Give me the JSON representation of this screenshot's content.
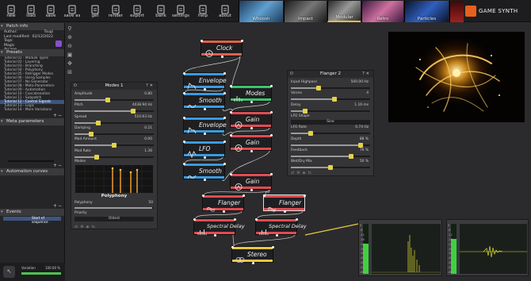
{
  "toolbar": {
    "buttons": [
      {
        "label": "new",
        "icon": "new-file-icon"
      },
      {
        "label": "load",
        "icon": "folder-icon"
      },
      {
        "label": "save",
        "icon": "save-icon"
      },
      {
        "label": "save as",
        "icon": "save-as-icon"
      },
      {
        "label": "get",
        "icon": "download-icon"
      },
      {
        "label": "render",
        "icon": "render-icon"
      },
      {
        "label": "export",
        "icon": "export-icon"
      },
      {
        "label": "bank",
        "icon": "bank-icon"
      },
      {
        "label": "settings",
        "icon": "gear-icon"
      },
      {
        "label": "help",
        "icon": "help-icon"
      },
      {
        "label": "about",
        "icon": "info-icon"
      }
    ],
    "tabs": [
      "Whoosh",
      "Impact",
      "Modular",
      "Retro",
      "Particles"
    ],
    "brand": "GAME SYNTH"
  },
  "left_panel": {
    "patch_info": {
      "header": "Patch info",
      "author_label": "Author:",
      "author_value": "Tsugi",
      "modified_label": "Last modified:",
      "modified_value": "02/12/2022",
      "tags_label": "Tags:",
      "tags_value": "Magic\nArcane"
    },
    "presets": {
      "header": "Presets",
      "items": [
        "Tutorial 01 - Module Types",
        "Tutorial 02 - Layering",
        "Tutorial 03 - Branching",
        "Tutorial 04 - Polyphony",
        "Tutorial 05 - Retrigger Modes",
        "Tutorial 06 - Using Samples",
        "Tutorial 07 - No Generator",
        "Tutorial 08 - Meta Parameters",
        "Tutorial 09 - Automation",
        "Tutorial 10 - Concatenation",
        "Tutorial 11 - Subpatch",
        "Tutorial 12 - Control Signals",
        "Tutorial 13 - Logic",
        "Tutorial 14 - More Variations"
      ],
      "selected": 11
    },
    "meta_parameters": {
      "header": "Meta parameters"
    },
    "automation_curves": {
      "header": "Automation curves"
    },
    "events": {
      "header": "Events",
      "event_value": "Start of sequence"
    },
    "status": {
      "variation_label": "Variation",
      "variation_value": "100.00 %"
    }
  },
  "modes_panel": {
    "title": "Modes 1",
    "params": [
      {
        "label": "Amplitude",
        "value": "0.80",
        "fill": 0.42
      },
      {
        "label": "Pitch",
        "value": "4038.94 Hz",
        "fill": 0.74
      },
      {
        "label": "Spread",
        "value": "510.63 Hz",
        "fill": 0.3
      },
      {
        "label": "Damping",
        "value": "0.21",
        "fill": 0.21
      },
      {
        "label": "Mod Amount",
        "value": "0.00",
        "fill": 0.5
      },
      {
        "label": "Mod Rate",
        "value": "1.36",
        "fill": 0.28
      }
    ],
    "modes_label": "Modes",
    "polyphony_header": "Polyphony",
    "polyphony_label": "Polyphony",
    "polyphony_value": "50",
    "priority_label": "Priority",
    "priority_value": "Oldest"
  },
  "flanger_panel": {
    "title": "Flanger 2",
    "params": [
      {
        "label": "Input Highpass",
        "value": "500.00 Hz",
        "fill": 0.35
      },
      {
        "label": "Voices",
        "value": "4",
        "fill": 0.55
      },
      {
        "label": "Delay",
        "value": "1.16 ms",
        "fill": 0.18
      },
      {
        "label": "LFO Shape",
        "value": "Sine",
        "type": "select"
      },
      {
        "label": "LFO Rate",
        "value": "0.74 Hz",
        "fill": 0.25
      },
      {
        "label": "Depth",
        "value": "88 %",
        "fill": 0.88
      },
      {
        "label": "Feedback",
        "value": "76 %",
        "fill": 0.76
      },
      {
        "label": "Wet/Dry Mix",
        "value": "50 %",
        "fill": 0.5
      }
    ]
  },
  "graph": {
    "nodes": [
      {
        "id": "clock",
        "label": "Clock",
        "color": "#e0614a",
        "icon": "clock-icon"
      },
      {
        "id": "envelope1",
        "label": "Envelope",
        "color": "#3a9be0",
        "icon": "envelope-icon"
      },
      {
        "id": "smooth1",
        "label": "Smooth",
        "color": "#3a9be0",
        "icon": "smooth-icon"
      },
      {
        "id": "modes",
        "label": "Modes",
        "color": "#3ec46b",
        "icon": "modes-icon"
      },
      {
        "id": "gain1",
        "label": "Gain",
        "color": "#e04c52",
        "icon": "gain-icon"
      },
      {
        "id": "envelope2",
        "label": "Envelope",
        "color": "#3a9be0",
        "icon": "envelope-icon"
      },
      {
        "id": "gain2",
        "label": "Gain",
        "color": "#e04c52",
        "icon": "gain-icon"
      },
      {
        "id": "lfo",
        "label": "LFO",
        "color": "#3a9be0",
        "icon": "lfo-icon"
      },
      {
        "id": "smooth2",
        "label": "Smooth",
        "color": "#3a9be0",
        "icon": "smooth-icon"
      },
      {
        "id": "gain3",
        "label": "Gain",
        "color": "#e04c52",
        "icon": "gain-icon"
      },
      {
        "id": "flanger1",
        "label": "Flanger",
        "color": "#e04c52",
        "icon": "flanger-icon"
      },
      {
        "id": "flanger2",
        "label": "Flanger",
        "color": "#e04c52",
        "icon": "flanger-icon"
      },
      {
        "id": "spectral1",
        "label": "Spectral Delay",
        "color": "#e04c52",
        "icon": "spectral-icon"
      },
      {
        "id": "spectral2",
        "label": "Spectral Delay",
        "color": "#e04c52",
        "icon": "spectral-icon"
      },
      {
        "id": "stereo",
        "label": "Stereo",
        "color": "#e8c640",
        "icon": "stereo-icon"
      }
    ]
  },
  "scopes": {
    "left_ticks": [
      "0",
      "-6",
      "-12",
      "-18",
      "-24",
      "-30",
      "-36",
      "-42",
      "-48",
      "-54",
      "-60"
    ],
    "right_ticks": [
      "0",
      "-6",
      "-12",
      "-18",
      "-24",
      "-30",
      "-36",
      "-42",
      "-48",
      "-54",
      "-60"
    ]
  }
}
